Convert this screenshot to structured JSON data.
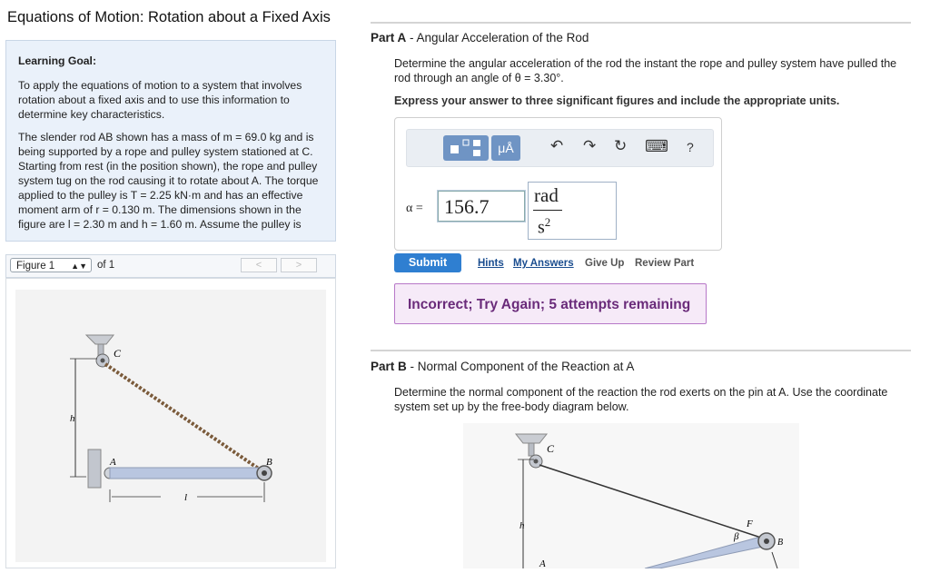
{
  "title": "Equations of Motion: Rotation about a Fixed Axis",
  "learning_goal": {
    "heading": "Learning Goal:",
    "paragraph1": "To apply the equations of motion to a system that involves rotation about a fixed axis and to use this information to determine key characteristics.",
    "paragraph2": "The slender rod AB shown has a mass of m = 69.0 kg and is being supported by a rope and pulley system stationed at C. Starting from rest (in the position shown), the rope and pulley system tug on the rod causing it to rotate about A. The torque applied to the pulley is T = 2.25 kN·m and has an effective moment arm of r = 0.130 m. The dimensions shown in the figure are l = 2.30 m and h = 1.60 m. Assume the pulley is"
  },
  "figure": {
    "selector": "Figure 1",
    "of_label": "of 1",
    "prev": "<",
    "next": ">",
    "labels": {
      "c": "C",
      "a": "A",
      "b": "B",
      "h": "h",
      "l": "l"
    }
  },
  "partA": {
    "prefix": "Part A",
    "title": "Angular Acceleration of the Rod",
    "question": "Determine the angular acceleration of the rod the instant the rope and pulley system have pulled the rod through an angle of θ = 3.30°.",
    "instruction": "Express your answer to three significant figures and include the appropriate units.",
    "toolbar": {
      "mu": "μÅ",
      "undo": "↶",
      "redo": "↷",
      "reset": "↻",
      "keyboard": "⌨",
      "help": "?"
    },
    "variable": "α =",
    "value": "156.7",
    "unit_num": "rad",
    "unit_den": "s",
    "unit_exp": "2",
    "submit": "Submit",
    "links": [
      "Hints",
      "My Answers",
      "Give Up",
      "Review Part"
    ],
    "feedback": "Incorrect; Try Again; 5 attempts remaining"
  },
  "partB": {
    "prefix": "Part B",
    "title": "Normal Component of the Reaction at A",
    "question": "Determine the normal component of the reaction the rod exerts on the pin at A. Use the coordinate system set up by the free-body diagram below.",
    "labels": {
      "c": "C",
      "h": "h",
      "f": "F",
      "beta": "β",
      "b": "B",
      "a": "A"
    }
  },
  "colors": {
    "goal_bg": "#eaf1fa",
    "accent": "#2f7fd1",
    "feedback_bg": "#f6eaf8",
    "feedback_text": "#6a2b7a",
    "toolbar_btn": "#6f94c4"
  }
}
